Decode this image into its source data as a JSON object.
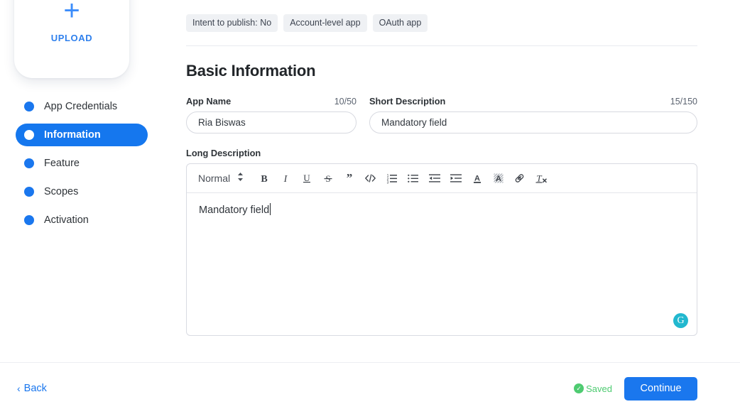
{
  "sidebar": {
    "upload": {
      "plus_icon": "plus-icon",
      "label": "UPLOAD"
    },
    "items": [
      {
        "label": "App Credentials",
        "active": false
      },
      {
        "label": "Information",
        "active": true
      },
      {
        "label": "Feature",
        "active": false
      },
      {
        "label": "Scopes",
        "active": false
      },
      {
        "label": "Activation",
        "active": false
      }
    ]
  },
  "chips": [
    {
      "label": "Intent to publish: No"
    },
    {
      "label": "Account-level app"
    },
    {
      "label": "OAuth app"
    }
  ],
  "main": {
    "section_title": "Basic Information",
    "app_name": {
      "label": "App Name",
      "counter": "10/50",
      "value": "Ria Biswas",
      "placeholder": "App Name"
    },
    "short_description": {
      "label": "Short Description",
      "counter": "15/150",
      "value": "Mandatory field",
      "placeholder": "Mandatory field"
    },
    "long_description": {
      "label": "Long Description",
      "body_text": "Mandatory field",
      "grammarly_badge": "G"
    }
  },
  "toolbar": {
    "format_select": "Normal",
    "buttons": [
      {
        "name": "bold-icon",
        "title": "Bold"
      },
      {
        "name": "italic-icon",
        "title": "Italic"
      },
      {
        "name": "underline-icon",
        "title": "Underline"
      },
      {
        "name": "strikethrough-icon",
        "title": "Strikethrough"
      },
      {
        "name": "blockquote-icon",
        "title": "Blockquote"
      },
      {
        "name": "code-icon",
        "title": "Code"
      },
      {
        "name": "ordered-list-icon",
        "title": "Ordered list"
      },
      {
        "name": "bullet-list-icon",
        "title": "Bullet list"
      },
      {
        "name": "outdent-icon",
        "title": "Decrease indent"
      },
      {
        "name": "indent-icon",
        "title": "Increase indent"
      },
      {
        "name": "font-color-icon",
        "title": "Text color"
      },
      {
        "name": "highlight-icon",
        "title": "Highlight"
      },
      {
        "name": "link-icon",
        "title": "Insert link"
      },
      {
        "name": "clear-format-icon",
        "title": "Clear formatting"
      }
    ]
  },
  "footer": {
    "back_label": "Back",
    "saved_label": "Saved",
    "continue_label": "Continue"
  },
  "colors": {
    "accent_blue": "#1a77ee",
    "saved_green": "#4ecb71",
    "grammarly_teal": "#22b8cf",
    "chip_bg": "#eff1f4"
  }
}
